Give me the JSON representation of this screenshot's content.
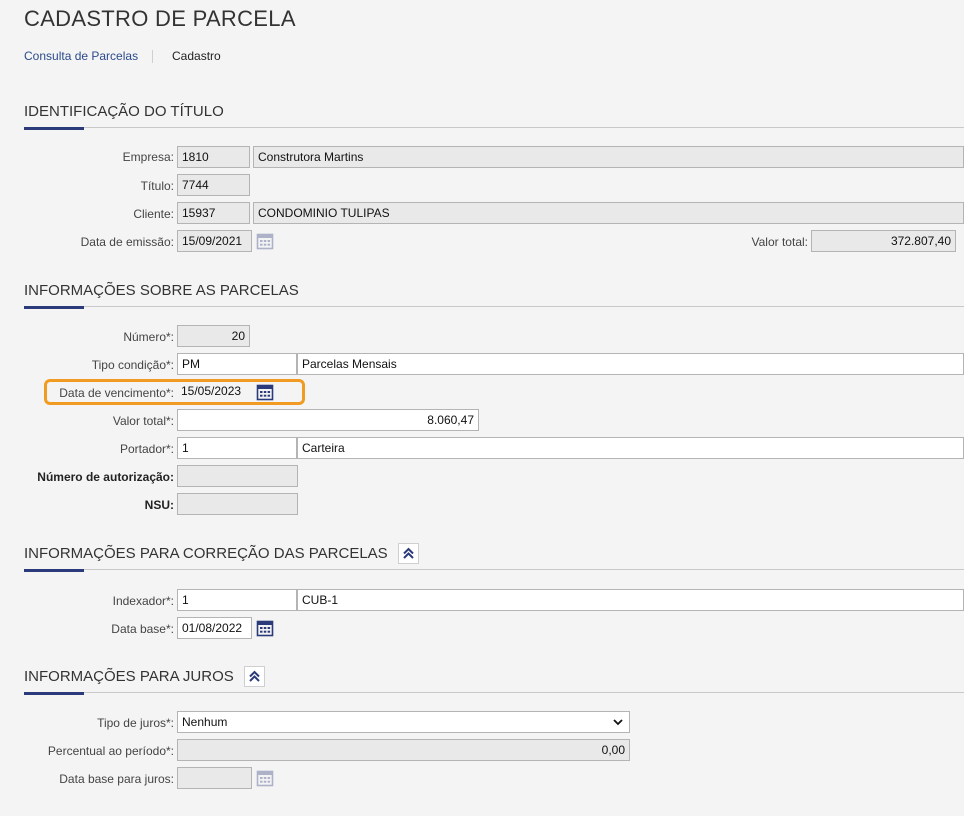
{
  "page": {
    "title": "CADASTRO DE PARCELA"
  },
  "breadcrumb": {
    "link": "Consulta de Parcelas",
    "current": "Cadastro"
  },
  "sections": {
    "titulo": {
      "title": "IDENTIFICAÇÃO DO TÍTULO"
    },
    "parcelas": {
      "title": "INFORMAÇÕES SOBRE AS PARCELAS"
    },
    "correcao": {
      "title": "INFORMAÇÕES PARA CORREÇÃO DAS PARCELAS"
    },
    "juros": {
      "title": "INFORMAÇÕES PARA JUROS"
    }
  },
  "titulo": {
    "empresa": {
      "label": "Empresa:",
      "code": "1810",
      "name": "Construtora Martins"
    },
    "titulo": {
      "label": "Título:",
      "value": "7744"
    },
    "cliente": {
      "label": "Cliente:",
      "code": "15937",
      "name": "CONDOMINIO TULIPAS"
    },
    "data_emissao": {
      "label": "Data de emissão:",
      "value": "15/09/2021"
    },
    "valor_total": {
      "label": "Valor total:",
      "value": "372.807,40"
    }
  },
  "parcelas": {
    "numero": {
      "label": "Número*:",
      "value": "20"
    },
    "tipo_condicao": {
      "label": "Tipo condição*:",
      "code": "PM",
      "name": "Parcelas Mensais"
    },
    "data_vencimento": {
      "label": "Data de vencimento*:",
      "value": "15/05/2023"
    },
    "valor_total": {
      "label": "Valor total*:",
      "value": "8.060,47"
    },
    "portador": {
      "label": "Portador*:",
      "code": "1",
      "name": "Carteira"
    },
    "numero_autorizacao": {
      "label": "Número de autorização:",
      "value": ""
    },
    "nsu": {
      "label": "NSU:",
      "value": ""
    }
  },
  "correcao": {
    "indexador": {
      "label": "Indexador*:",
      "code": "1",
      "name": "CUB-1"
    },
    "data_base": {
      "label": "Data base*:",
      "value": "01/08/2022"
    }
  },
  "juros": {
    "tipo_juros": {
      "label": "Tipo de juros*:",
      "value": "Nenhum"
    },
    "percentual": {
      "label": "Percentual ao período*:",
      "value": "0,00"
    },
    "data_base_juros": {
      "label": "Data base para juros:",
      "value": ""
    }
  },
  "colors": {
    "accent": "#2b3a7a",
    "highlight": "#f29b22",
    "link": "#2b4a8b"
  }
}
